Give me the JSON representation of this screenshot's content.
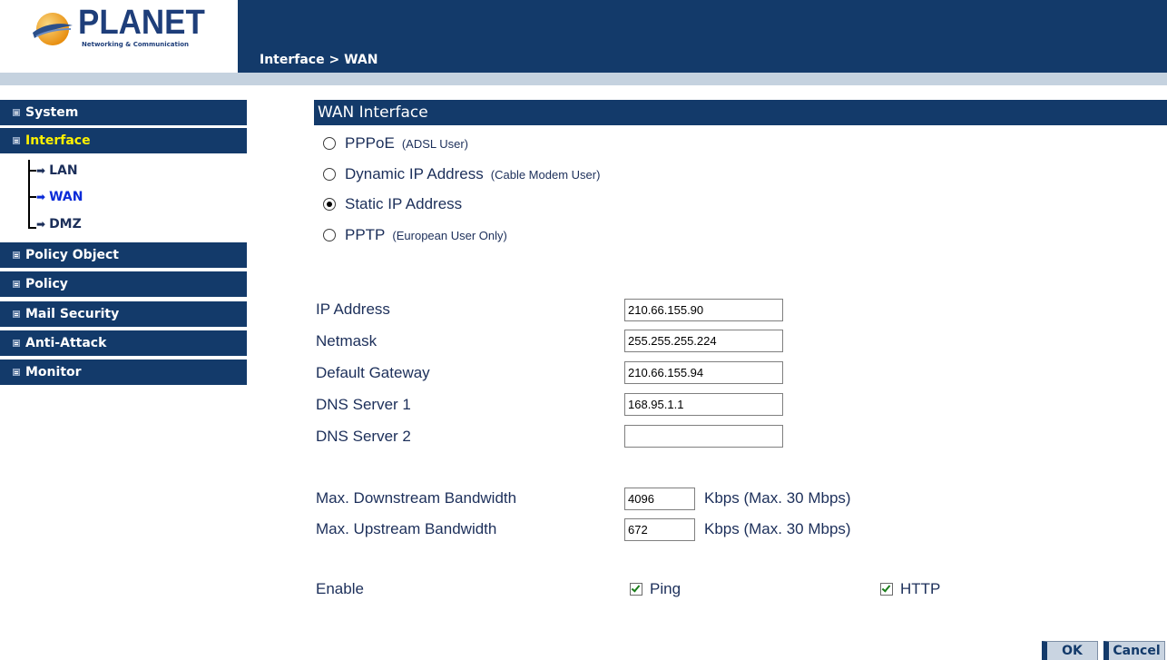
{
  "header": {
    "logo_text": "PLANET",
    "logo_sub": "Networking & Communication",
    "breadcrumb": "Interface > WAN"
  },
  "sidebar": {
    "items": [
      {
        "label": "System"
      },
      {
        "label": "Interface",
        "active": true
      },
      {
        "label": "Policy Object"
      },
      {
        "label": "Policy"
      },
      {
        "label": "Mail Security"
      },
      {
        "label": "Anti-Attack"
      },
      {
        "label": "Monitor"
      }
    ],
    "sub_items": [
      {
        "label": "LAN"
      },
      {
        "label": "WAN",
        "active": true
      },
      {
        "label": "DMZ"
      }
    ]
  },
  "main": {
    "title": "WAN Interface",
    "modes": [
      {
        "label": "PPPoE",
        "note": "(ADSL User)",
        "checked": false
      },
      {
        "label": "Dynamic IP Address",
        "note": "(Cable Modem User)",
        "checked": false
      },
      {
        "label": "Static IP Address",
        "note": "",
        "checked": true
      },
      {
        "label": "PPTP",
        "note": "(European User Only)",
        "checked": false
      }
    ],
    "fields": {
      "ip_address": {
        "label": "IP Address",
        "value": "210.66.155.90"
      },
      "netmask": {
        "label": "Netmask",
        "value": "255.255.255.224"
      },
      "gateway": {
        "label": "Default Gateway",
        "value": "210.66.155.94"
      },
      "dns1": {
        "label": "DNS Server 1",
        "value": "168.95.1.1"
      },
      "dns2": {
        "label": "DNS Server 2",
        "value": ""
      }
    },
    "bandwidth": {
      "down_label": "Max. Downstream Bandwidth",
      "down_value": "4096",
      "up_label": "Max. Upstream Bandwidth",
      "up_value": "672",
      "unit": "Kbps (Max. 30 Mbps)"
    },
    "enable": {
      "label": "Enable",
      "ping_label": "Ping",
      "http_label": "HTTP"
    },
    "buttons": {
      "ok": "OK",
      "cancel": "Cancel"
    }
  },
  "colors": {
    "navy": "#133a6a",
    "subbar": "#c5d2df",
    "active_menu": "#fff200",
    "active_sub": "#0a2bd8"
  }
}
